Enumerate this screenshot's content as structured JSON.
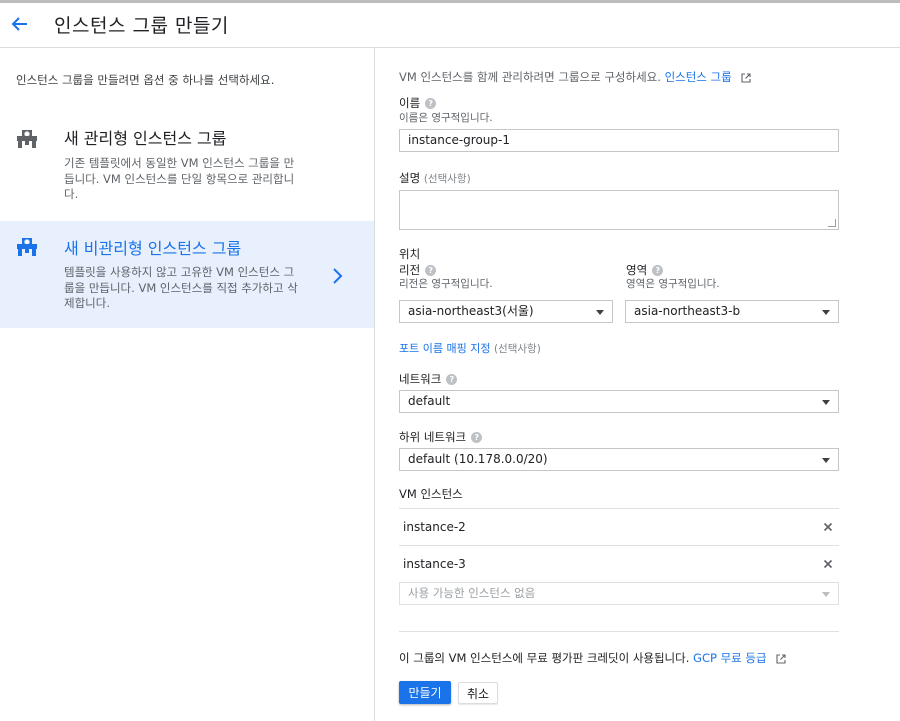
{
  "header": {
    "title": "인스턴스 그룹 만들기"
  },
  "left": {
    "intro": "인스턴스 그룹을 만들려면 옵션 중 하나를 선택하세요.",
    "options": [
      {
        "title": "새 관리형 인스턴스 그룹",
        "desc": "기존 템플릿에서 동일한 VM 인스턴스 그룹을 만듭니다. VM 인스턴스를 단일 항목으로 관리합니다."
      },
      {
        "title": "새 비관리형 인스턴스 그룹",
        "desc": "템플릿을 사용하지 않고 고유한 VM 인스턴스 그룹을 만듭니다. VM 인스턴스를 직접 추가하고 삭제합니다."
      }
    ]
  },
  "form": {
    "intro_text": "VM 인스턴스를 함께 관리하려면 그룹으로 구성하세요.",
    "intro_link": "인스턴스 그룹",
    "name_label": "이름",
    "name_sub": "이름은 영구적입니다.",
    "name_value": "instance-group-1",
    "desc_label": "설명",
    "optional": "(선택사항)",
    "location_label": "위치",
    "region_label": "리전",
    "region_sub": "리전은 영구적입니다.",
    "region_value": "asia-northeast3(서울)",
    "zone_label": "영역",
    "zone_sub": "영역은 영구적입니다.",
    "zone_value": "asia-northeast3-b",
    "port_link": "포트 이름 매핑 지정",
    "network_label": "네트워크",
    "network_value": "default",
    "subnet_label": "하위 네트워크",
    "subnet_value": "default (10.178.0.0/20)",
    "vm_label": "VM 인스턴스",
    "vm_instances": [
      "instance-2",
      "instance-3"
    ],
    "vm_placeholder": "사용 가능한 인스턴스 없음",
    "credit_text": "이 그룹의 VM 인스턴스에 무료 평가판 크레딧이 사용됩니다.",
    "credit_link": "GCP 무료 등급",
    "create_label": "만들기",
    "cancel_label": "취소"
  },
  "colors": {
    "accent": "#1a73e8",
    "selected_bg": "#e8f0fe"
  },
  "icons": [
    "back-arrow-icon",
    "instance-group-icon",
    "chevron-right-icon",
    "help-icon",
    "external-link-icon",
    "close-icon",
    "dropdown-arrow-icon"
  ]
}
